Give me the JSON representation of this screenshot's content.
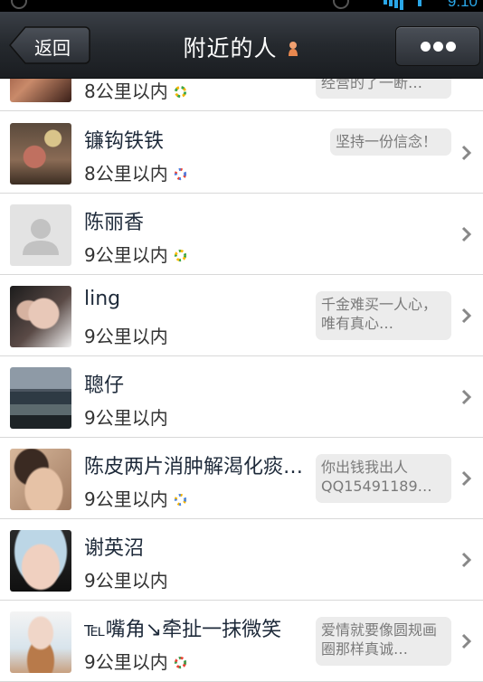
{
  "status": {
    "clock": "9:10"
  },
  "header": {
    "back_label": "返回",
    "title": "附近的人"
  },
  "rows": [
    {
      "name": "",
      "distance": "8公里以内",
      "signature": "经营的了一断…",
      "has_ring": true
    },
    {
      "name": "镰钩铁铁",
      "distance": "8公里以内",
      "signature": "坚持一份信念！",
      "has_ring": true
    },
    {
      "name": "陈丽香",
      "distance": "9公里以内",
      "signature": "",
      "has_ring": true
    },
    {
      "name": "ling",
      "distance": "9公里以内",
      "signature": "千金难买一人心，唯有真心…",
      "has_ring": false
    },
    {
      "name": "聰仔",
      "distance": "9公里以内",
      "signature": "",
      "has_ring": false
    },
    {
      "name": "陈皮两片消肿解渴化痰…",
      "distance": "9公里以内",
      "signature": "你出钱我出人QQ15491189…",
      "has_ring": true
    },
    {
      "name": "谢英沼",
      "distance": "9公里以内",
      "signature": "",
      "has_ring": false
    },
    {
      "name": "℡嘴角↘牵扯一抹微笑",
      "distance": "9公里以内",
      "signature": "爱情就要像圆规画圈那样真诚…",
      "has_ring": true
    }
  ]
}
